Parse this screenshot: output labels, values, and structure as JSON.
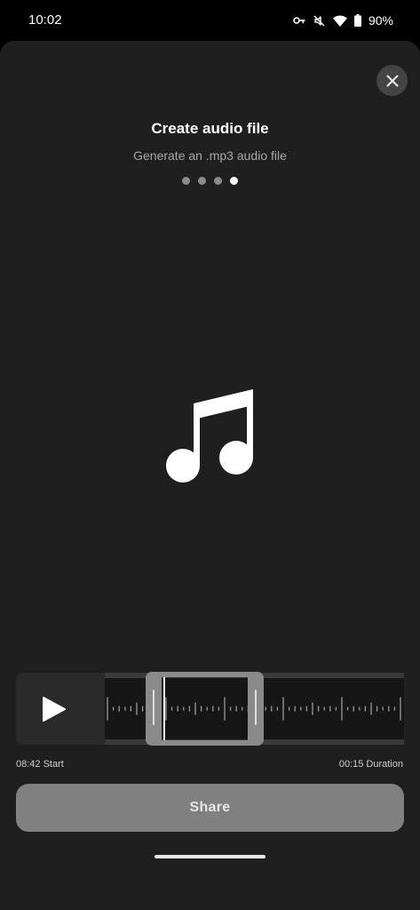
{
  "status_bar": {
    "time": "10:02",
    "battery": "90%",
    "icons": [
      "vpn-key-icon",
      "mute-icon",
      "wifi-icon",
      "battery-icon"
    ]
  },
  "dialog": {
    "title": "Create audio file",
    "subtitle": "Generate an .mp3 audio file",
    "steps": {
      "total": 4,
      "current": 4
    },
    "close_icon": "close-icon",
    "illustration_icon": "music-note-icon"
  },
  "player": {
    "play_icon": "play-icon",
    "start_label": "08:42 Start",
    "duration_label": "00:15 Duration"
  },
  "actions": {
    "share_label": "Share"
  },
  "colors": {
    "sheet_background": "#1f1f1f",
    "share_button": "#808080",
    "active_dot": "#ffffff",
    "inactive_dot": "#8a8a8a"
  }
}
